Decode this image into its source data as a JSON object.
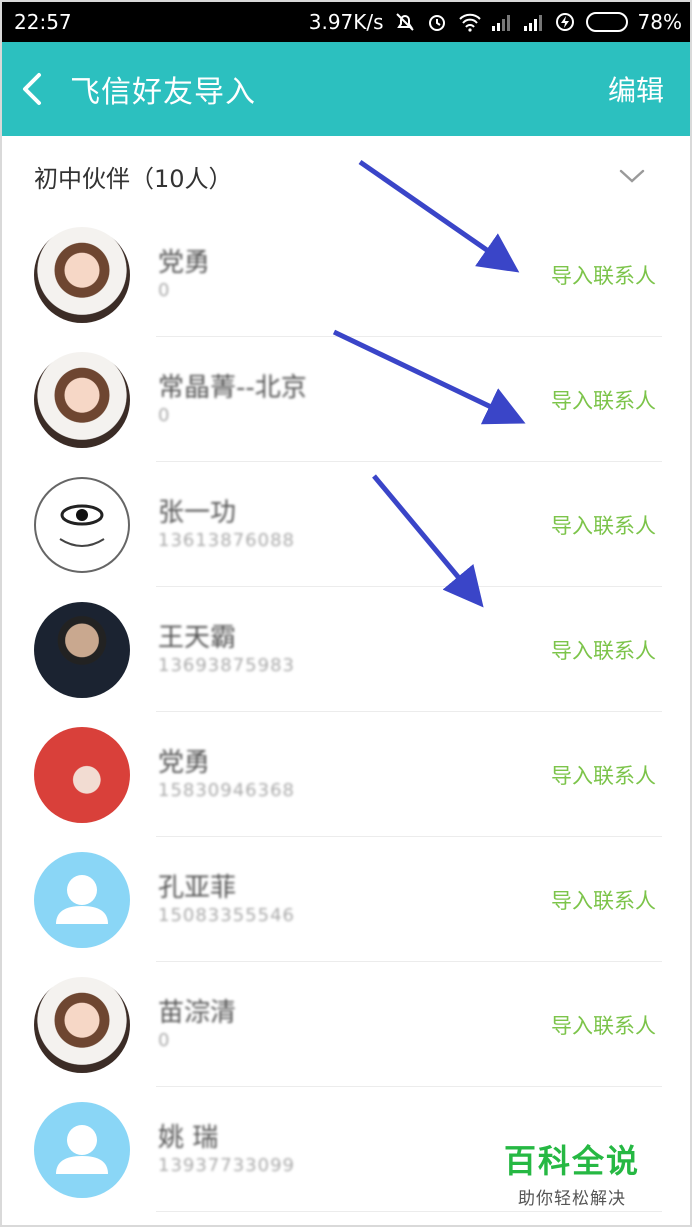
{
  "status_bar": {
    "time": "22:57",
    "net_speed": "3.97K/s",
    "battery": "78%",
    "battery_level": 0.78,
    "battery_color": "#36d23b",
    "icons": [
      "mute-icon",
      "alarm-icon",
      "wifi-icon",
      "signal-icon",
      "signal-icon",
      "charging-icon"
    ]
  },
  "header": {
    "back_icon": "chevron-left-icon",
    "title": "飞信好友导入",
    "edit_label": "编辑",
    "bg_color": "#2cc0bf"
  },
  "group": {
    "label": "初中伙伴（10人）",
    "chevron_icon": "chevron-down-icon"
  },
  "contacts": [
    {
      "name": "党勇",
      "phone": "0",
      "avatar": "photo-girl",
      "action": "导入联系人"
    },
    {
      "name": "常晶菁--北京",
      "phone": "0",
      "avatar": "photo-girl",
      "action": "导入联系人"
    },
    {
      "name": "张一功",
      "phone": "13613876088",
      "avatar": "photo-eye",
      "action": "导入联系人"
    },
    {
      "name": "王天霸",
      "phone": "13693875983",
      "avatar": "photo-man",
      "action": "导入联系人"
    },
    {
      "name": "党勇",
      "phone": "15830946368",
      "avatar": "photo-red",
      "action": "导入联系人"
    },
    {
      "name": "孔亚菲",
      "phone": "15083355546",
      "avatar": "default-person-icon",
      "action": "导入联系人"
    },
    {
      "name": "苗淙清",
      "phone": "0",
      "avatar": "photo-girl",
      "action": "导入联系人"
    },
    {
      "name": "姚 瑞",
      "phone": "13937733099",
      "avatar": "default-person-icon",
      "action": ""
    }
  ],
  "accent_color": "#7cc44a",
  "arrow_color": "#3a45c8",
  "watermark": {
    "title": "百科全说",
    "subtitle": "助你轻松解决"
  }
}
